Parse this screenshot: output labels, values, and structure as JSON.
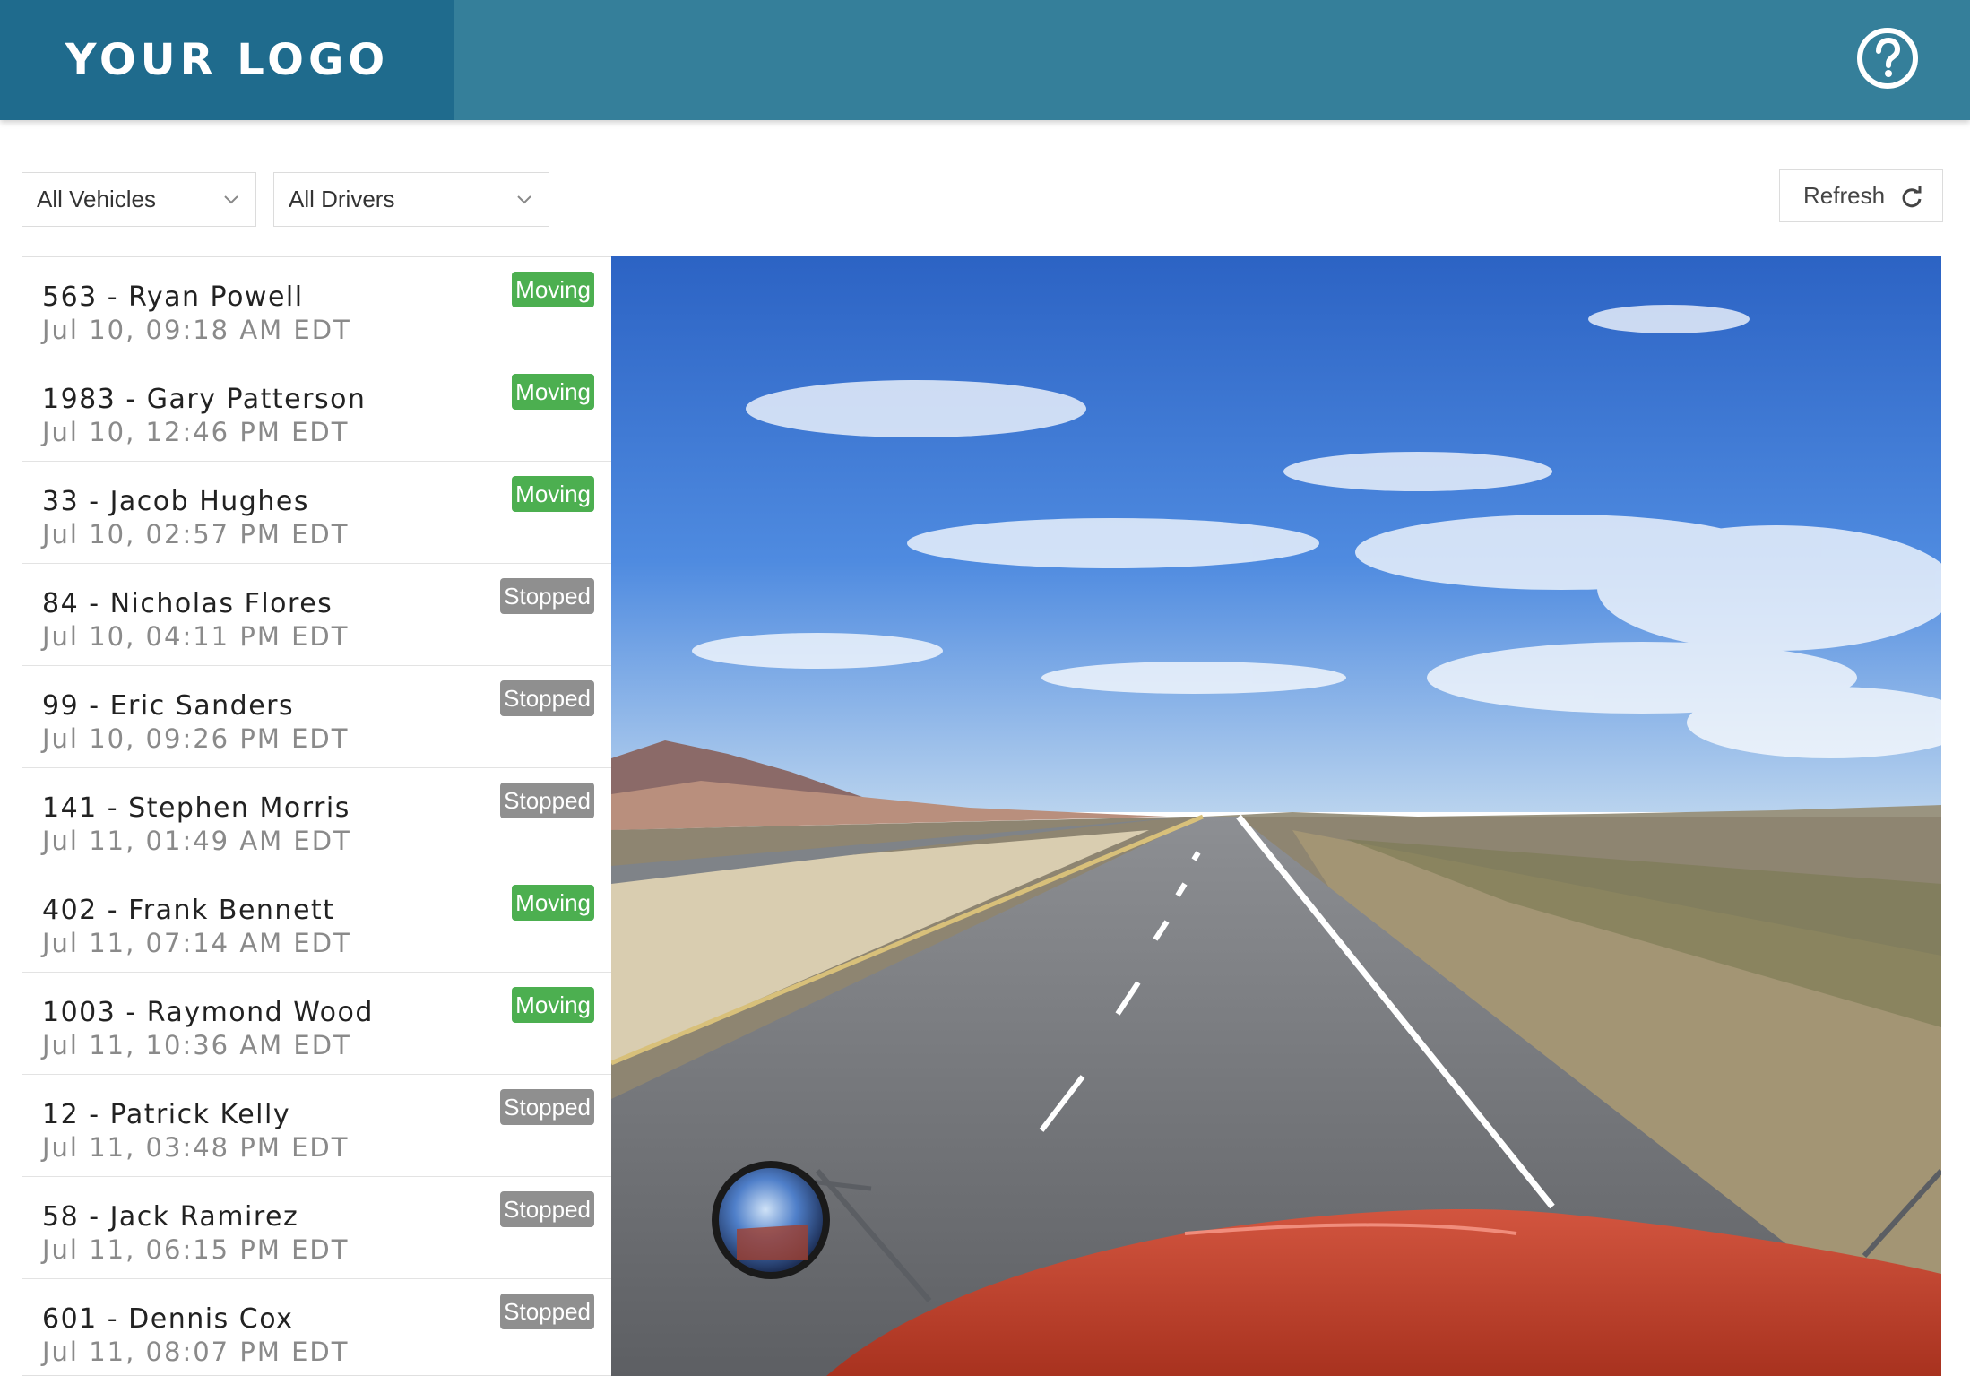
{
  "header": {
    "logo_text": "YOUR LOGO",
    "help_icon": "help-circle-icon",
    "bg_color": "#357f9a",
    "logo_bg_color": "#1f6b8d"
  },
  "filters": {
    "vehicles": {
      "selected": "All Vehicles"
    },
    "drivers": {
      "selected": "All Drivers"
    },
    "refresh_label": "Refresh",
    "refresh_icon": "refresh-icon"
  },
  "status_colors": {
    "Moving": "#4caf50",
    "Stopped": "#8f8f8f"
  },
  "vehicles": [
    {
      "name": "563 - Ryan Powell",
      "time": "Jul 10, 09:18 AM EDT",
      "status": "Moving"
    },
    {
      "name": "1983 - Gary Patterson",
      "time": "Jul 10, 12:46 PM EDT",
      "status": "Moving"
    },
    {
      "name": "33 - Jacob Hughes",
      "time": "Jul 10, 02:57 PM EDT",
      "status": "Moving"
    },
    {
      "name": "84 - Nicholas Flores",
      "time": "Jul 10, 04:11 PM EDT",
      "status": "Stopped"
    },
    {
      "name": "99 - Eric Sanders",
      "time": "Jul 10, 09:26 PM EDT",
      "status": "Stopped"
    },
    {
      "name": "141 - Stephen Morris",
      "time": "Jul 11, 01:49 AM EDT",
      "status": "Stopped"
    },
    {
      "name": "402 - Frank Bennett",
      "time": "Jul 11, 07:14 AM EDT",
      "status": "Moving"
    },
    {
      "name": "1003 - Raymond Wood",
      "time": "Jul 11, 10:36 AM EDT",
      "status": "Moving"
    },
    {
      "name": "12 - Patrick Kelly",
      "time": "Jul 11, 03:48 PM EDT",
      "status": "Stopped"
    },
    {
      "name": "58 - Jack Ramirez",
      "time": "Jul 11, 06:15 PM EDT",
      "status": "Stopped"
    },
    {
      "name": "601 - Dennis Cox",
      "time": "Jul 11, 08:07 PM EDT",
      "status": "Stopped"
    }
  ]
}
